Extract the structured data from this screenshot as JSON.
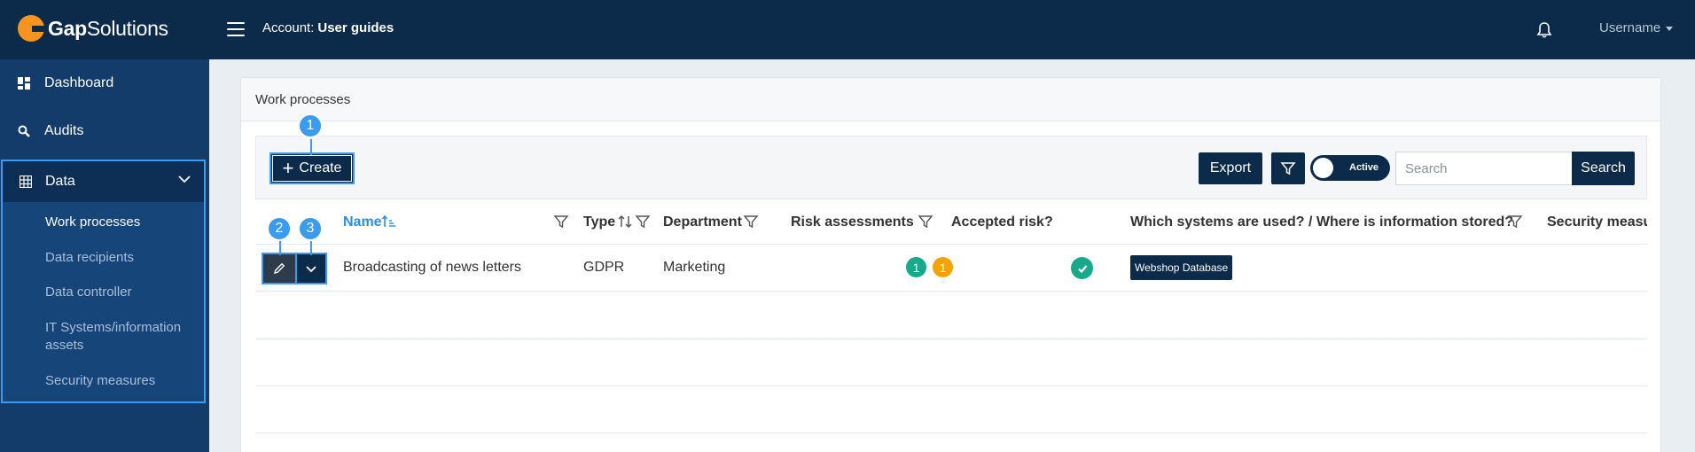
{
  "brand": {
    "name_bold": "Gap",
    "name_light": "Solutions"
  },
  "header": {
    "account_label": "Account:",
    "account_value": "User guides",
    "username": "Username"
  },
  "sidebar": {
    "items": [
      {
        "label": "Dashboard",
        "icon": "dashboard-icon"
      },
      {
        "label": "Audits",
        "icon": "search-icon"
      }
    ],
    "group": {
      "label": "Data",
      "icon": "table-icon",
      "expanded": true,
      "sub_items": [
        {
          "label": "Work processes",
          "active": true
        },
        {
          "label": "Data recipients",
          "active": false
        },
        {
          "label": "Data controller",
          "active": false
        },
        {
          "label": "IT Systems/information assets",
          "active": false
        },
        {
          "label": "Security measures",
          "active": false
        }
      ]
    }
  },
  "page": {
    "title": "Work processes"
  },
  "toolbar": {
    "create_label": "Create",
    "export_label": "Export",
    "toggle_label": "Active",
    "toggle_on": true,
    "search_placeholder": "Search",
    "search_label": "Search"
  },
  "table": {
    "headers": {
      "name": "Name",
      "type": "Type",
      "department": "Department",
      "risk": "Risk assessments",
      "accepted": "Accepted risk?",
      "systems": "Which systems are used? / Where is information stored?",
      "security": "Security measu"
    },
    "rows": [
      {
        "name": "Broadcasting of news letters",
        "type": "GDPR",
        "department": "Marketing",
        "risk_counts": [
          {
            "value": "1",
            "color": "#17a98a"
          },
          {
            "value": "1",
            "color": "#f5a300"
          }
        ],
        "accepted": true,
        "systems": [
          "Webshop Database"
        ]
      }
    ]
  },
  "markers": [
    "1",
    "2",
    "3"
  ],
  "colors": {
    "navy": "#0c2a4a",
    "sidebar": "#133c6b",
    "accent": "#3a9bf0",
    "orange": "#f7931e",
    "green": "#17a98a",
    "amber": "#f5a300"
  }
}
